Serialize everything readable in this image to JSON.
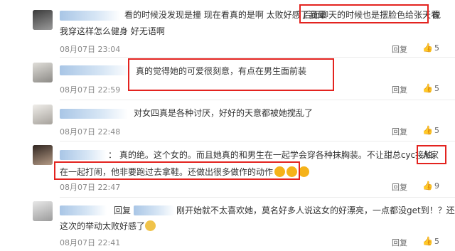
{
  "comments": [
    {
      "line1": "看的时候没发现是撞 现在看真的是啊 太败好感了我晕",
      "line1b": "后面聊天的时候也是摆脸色给张天看",
      "line1c": "说",
      "line2": "我穿这样怎么健身 好无语啊",
      "time": "08月07日 23:04",
      "reply": "回复",
      "likes": "5"
    },
    {
      "line1": "真的觉得她的可爱很刻意，有点在男生面前装",
      "time": "08月07日 22:59",
      "reply": "回复",
      "likes": "5"
    },
    {
      "line1": "对女四真是各种讨厌，好好的天意都被她搅乱了",
      "time": "08月07日 22:48",
      "reply": "回复",
      "likes": "5"
    },
    {
      "line1": "：  真的绝。这个女的。而且她真的和男生在一起学会穿各种抹胸装。不让甜总cyc接触。",
      "line1b": "人家",
      "line2": "在一起打闹，他非要跑过去拿鞋。还做出很多做作的动作",
      "time": "08月07日 22:47",
      "reply": "回复",
      "likes": "9"
    },
    {
      "line1a": "回复",
      "line1": "刚开始就不太喜欢她，莫名好多人说这女的好漂亮，一点都没get到！？还很矮",
      "line2": "这次的举动太败好感了",
      "time": "08月07日 22:41",
      "reply": "回复",
      "likes": "5"
    }
  ],
  "colors": {
    "highlight": "#e3231f",
    "name": "#a9c6e6"
  },
  "icons": {
    "like": "thumbs-up-icon",
    "clap": "clap-emoji-icon",
    "sad": "crying-emoji-icon"
  }
}
